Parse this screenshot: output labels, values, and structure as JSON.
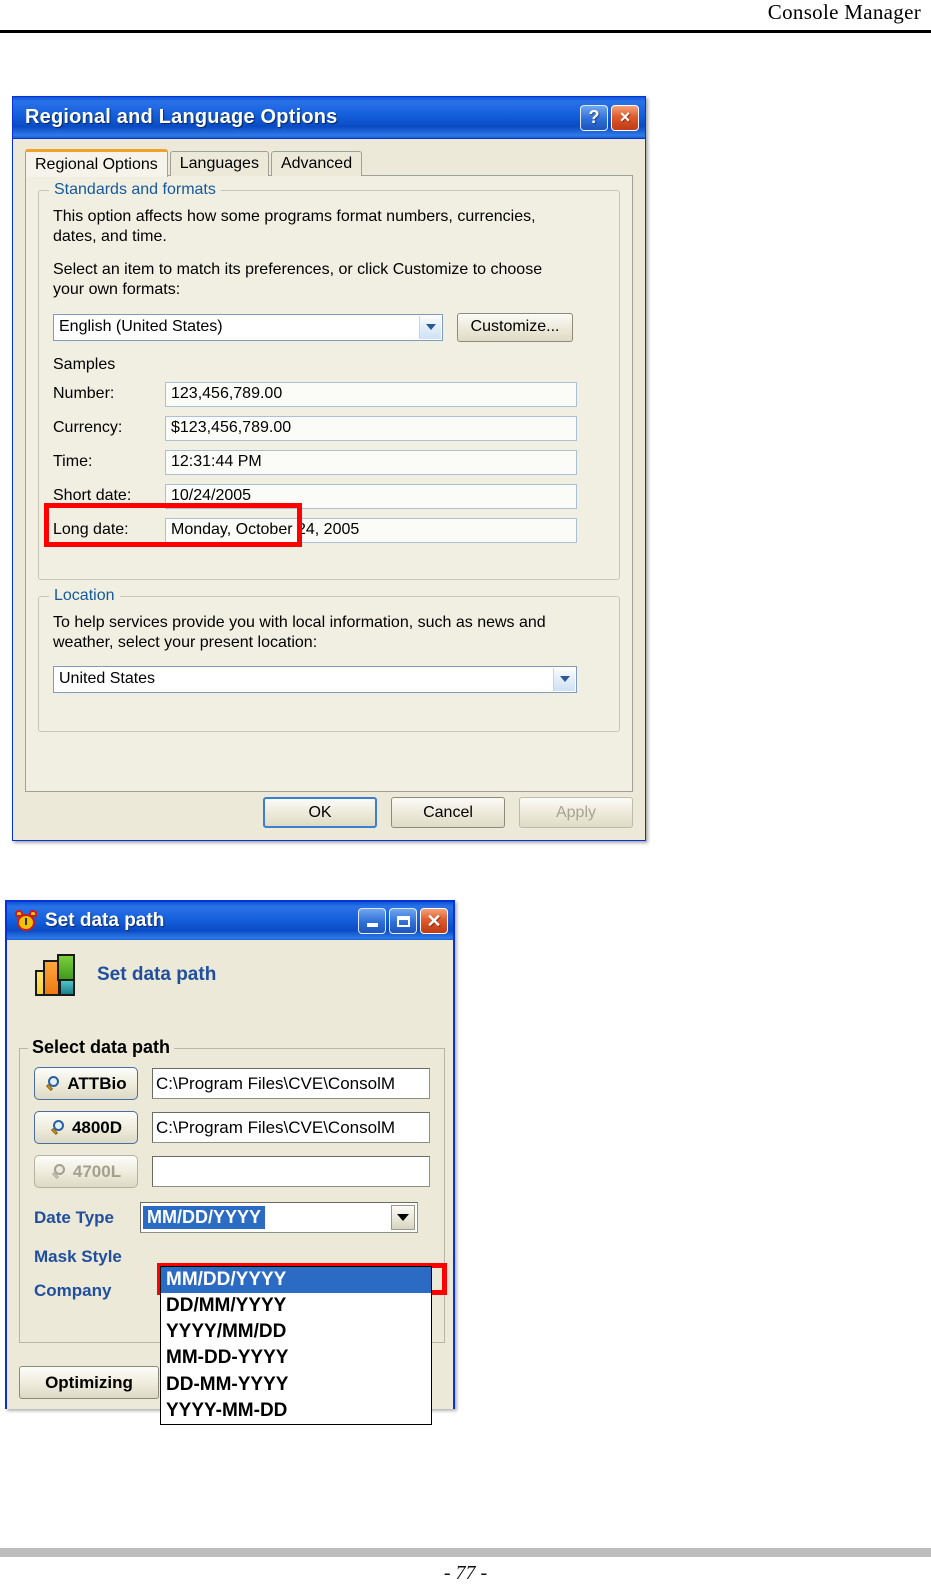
{
  "page": {
    "header_title": "Console Manager",
    "page_number": "- 77 -"
  },
  "regional_window": {
    "title": "Regional and Language Options",
    "help_glyph": "?",
    "close_glyph": "×",
    "tabs": [
      {
        "label": "Regional Options",
        "active": true
      },
      {
        "label": "Languages",
        "active": false
      },
      {
        "label": "Advanced",
        "active": false
      }
    ],
    "standards_group": {
      "title": "Standards and formats",
      "paragraph1": "This option affects how some programs format numbers, currencies, dates, and time.",
      "paragraph2": "Select an item to match its preferences, or click Customize to choose your own formats:",
      "locale_value": "English (United States)",
      "customize_label": "Customize...",
      "samples_label": "Samples",
      "samples": [
        {
          "label": "Number:",
          "value": "123,456,789.00"
        },
        {
          "label": "Currency:",
          "value": "$123,456,789.00"
        },
        {
          "label": "Time:",
          "value": "12:31:44 PM"
        },
        {
          "label": "Short date:",
          "value": "10/24/2005"
        },
        {
          "label": "Long date:",
          "value": "Monday, October 24, 2005"
        }
      ]
    },
    "location_group": {
      "title": "Location",
      "paragraph": "To help services provide you with local information, such as news and weather, select your present location:",
      "value": "United States"
    },
    "buttons": {
      "ok": "OK",
      "cancel": "Cancel",
      "apply": "Apply"
    }
  },
  "datapath_window": {
    "title": "Set data path",
    "titlebar_icon": "alarm-clock-icon",
    "header_icon": "blocks-icon",
    "header_title": "Set data path",
    "group_title": "Select data path",
    "rows": [
      {
        "button": "ATTBio",
        "value": "C:\\Program Files\\CVE\\ConsolM",
        "disabled": false
      },
      {
        "button": "4800D",
        "value": "C:\\Program Files\\CVE\\ConsolM",
        "disabled": false
      },
      {
        "button": "4700L",
        "value": "",
        "disabled": true
      }
    ],
    "fields": [
      {
        "label": "Date Type",
        "value": "MM/DD/YYYY"
      },
      {
        "label": "Mask Style",
        "value": ""
      },
      {
        "label": "Company",
        "value": ""
      }
    ],
    "date_type_options": [
      "MM/DD/YYYY",
      "DD/MM/YYYY",
      "YYYY/MM/DD",
      "MM-DD-YYYY",
      "DD-MM-YYYY",
      "YYYY-MM-DD"
    ],
    "date_type_selected": "MM/DD/YYYY",
    "bottom_buttons": [
      "Optimizing"
    ]
  },
  "annotations": {
    "accent_color": "#ff0000",
    "highlight_short_date": "Short date: 10/24/2005",
    "highlight_option": "MM/DD/YYYY"
  }
}
